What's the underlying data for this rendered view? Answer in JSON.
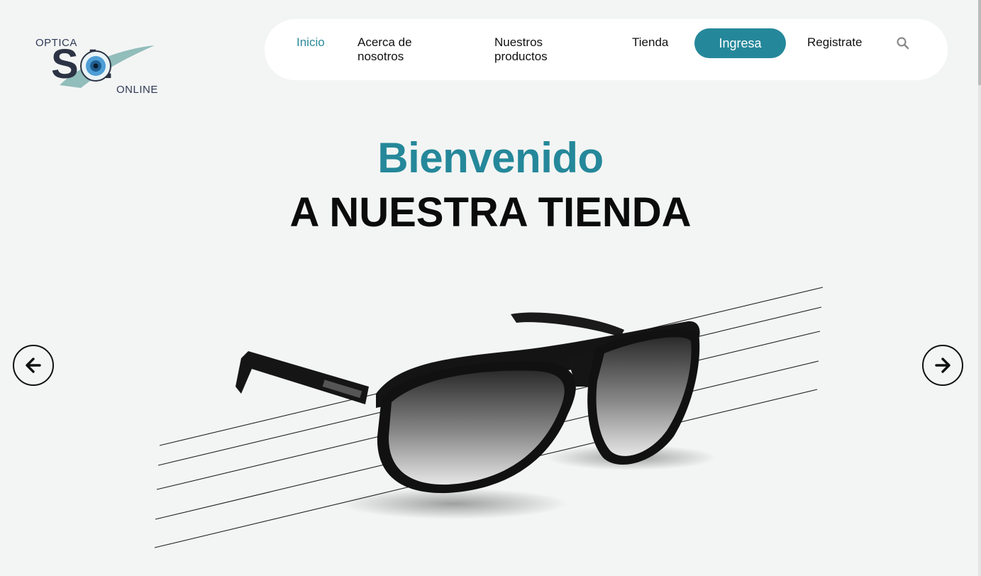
{
  "logo": {
    "top_text": "OPTICA",
    "main_text": "S L",
    "bottom_text": "ONLINE"
  },
  "nav": {
    "items": [
      {
        "label": "Inicio"
      },
      {
        "label": "Acerca de nosotros"
      },
      {
        "label": "Nuestros productos"
      },
      {
        "label": "Tienda"
      },
      {
        "label": "Registrate"
      }
    ],
    "login_button": "Ingresa",
    "search_icon": "search-icon"
  },
  "hero": {
    "title": "Bienvenido",
    "subtitle": "A NUESTRA TIENDA"
  },
  "carousel": {
    "prev_icon": "arrow-left-icon",
    "next_icon": "arrow-right-icon"
  },
  "colors": {
    "accent": "#25889a",
    "background": "#f3f5f4",
    "nav_bg": "#ffffff",
    "text": "#111111"
  }
}
